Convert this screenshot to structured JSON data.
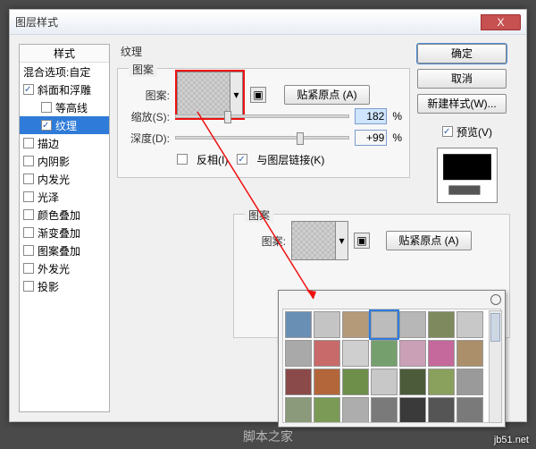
{
  "window": {
    "title": "图层样式",
    "close": "X"
  },
  "sidebar": {
    "header": "样式",
    "blend": "混合选项:自定",
    "items": [
      {
        "label": "斜面和浮雕",
        "checked": true,
        "sub": false
      },
      {
        "label": "等高线",
        "checked": false,
        "sub": true
      },
      {
        "label": "纹理",
        "checked": true,
        "sub": true,
        "selected": true
      },
      {
        "label": "描边",
        "checked": false,
        "sub": false
      },
      {
        "label": "内阴影",
        "checked": false,
        "sub": false
      },
      {
        "label": "内发光",
        "checked": false,
        "sub": false
      },
      {
        "label": "光泽",
        "checked": false,
        "sub": false
      },
      {
        "label": "颜色叠加",
        "checked": false,
        "sub": false
      },
      {
        "label": "渐变叠加",
        "checked": false,
        "sub": false
      },
      {
        "label": "图案叠加",
        "checked": false,
        "sub": false
      },
      {
        "label": "外发光",
        "checked": false,
        "sub": false
      },
      {
        "label": "投影",
        "checked": false,
        "sub": false
      }
    ]
  },
  "texture": {
    "title": "纹理",
    "sub_title": "图案",
    "pattern_label": "图案:",
    "snap_btn": "贴紧原点 (A)",
    "scale_label": "缩放(S):",
    "scale_value": "182",
    "depth_label": "深度(D):",
    "depth_value": "+99",
    "pct": "%",
    "invert": {
      "label": "反相(I)",
      "checked": false
    },
    "link": {
      "label": "与图层链接(K)",
      "checked": true
    }
  },
  "panel2": {
    "title": "图案",
    "pattern_label": "图案:",
    "snap_btn": "贴紧原点 (A)",
    "pct": "%"
  },
  "right": {
    "ok": "确定",
    "cancel": "取消",
    "newstyle": "新建样式(W)...",
    "preview": {
      "label": "预览(V)",
      "checked": true
    }
  },
  "popup": {
    "swatches": [
      "#6a8fb5",
      "#c4c4c4",
      "#b59a7a",
      "#bcbcbc",
      "#b7b7b7",
      "#7e8a5d",
      "#c8c8c8",
      "#a9a9a9",
      "#c86a6a",
      "#cfcfcf",
      "#75a06d",
      "#c9a0b5",
      "#c5689b",
      "#aa8f6a",
      "#8b4a4a",
      "#b4663b",
      "#6d8f4a",
      "#c8c8c8",
      "#4c5b3a",
      "#8aa05d",
      "#9a9a9a",
      "#8a9a7a",
      "#7a9a55",
      "#adadad",
      "#7a7a7a",
      "#3a3a3a",
      "#555555",
      "#7a7a7a"
    ],
    "selected_index": 3
  },
  "watermark": "jb51.net",
  "footer": "脚本之家"
}
